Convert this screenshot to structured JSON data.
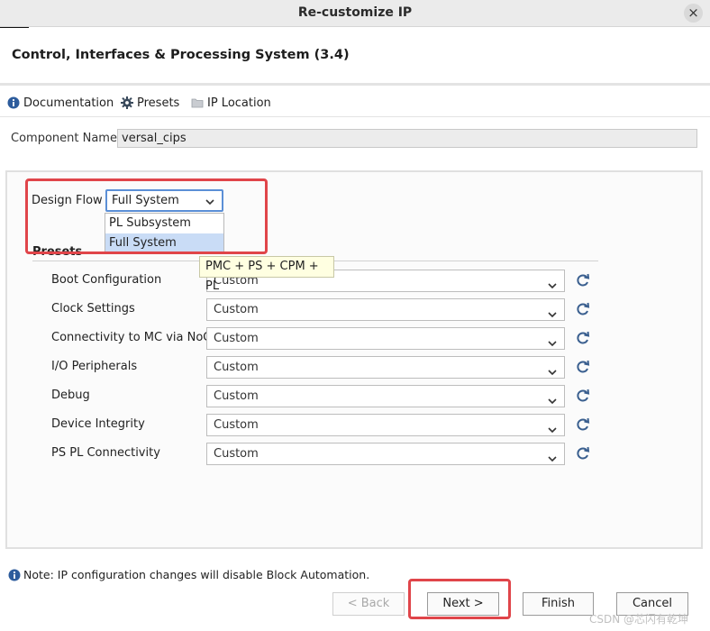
{
  "window": {
    "title": "Re-customize IP",
    "close_glyph": "×"
  },
  "header": {
    "title": "Control, Interfaces & Processing System (3.4)",
    "logo_icon": "amd-logo-icon"
  },
  "toolbar": {
    "items": [
      {
        "label": "Documentation",
        "icon": "info-icon"
      },
      {
        "label": "Presets",
        "icon": "gear-icon"
      },
      {
        "label": "IP Location",
        "icon": "folder-icon"
      }
    ]
  },
  "component": {
    "label": "Component Name",
    "value": "versal_cips"
  },
  "design_flow": {
    "label": "Design Flow",
    "selected": "Full System",
    "options": [
      "PL Subsystem",
      "Full System"
    ]
  },
  "presets": {
    "label": "Presets",
    "tooltip": "PMC + PS + CPM + PL",
    "rows": [
      {
        "label": "Boot Configuration",
        "value": "Custom"
      },
      {
        "label": "Clock Settings",
        "value": "Custom"
      },
      {
        "label": "Connectivity to MC via NoC",
        "value": "Custom"
      },
      {
        "label": "I/O Peripherals",
        "value": "Custom"
      },
      {
        "label": "Debug",
        "value": "Custom"
      },
      {
        "label": "Device Integrity",
        "value": "Custom"
      },
      {
        "label": "PS PL Connectivity",
        "value": "Custom"
      }
    ]
  },
  "note": {
    "text": "Note: IP configuration changes will disable Block Automation."
  },
  "footer": {
    "back": "< Back",
    "next": "Next >",
    "finish": "Finish",
    "cancel": "Cancel"
  },
  "watermark": "CSDN @芯闪有乾坤",
  "colors": {
    "highlight": "#e0454a",
    "selection": "#c9dcf6",
    "focus": "#5b8fd6",
    "tooltip_bg": "#ffffe1"
  }
}
